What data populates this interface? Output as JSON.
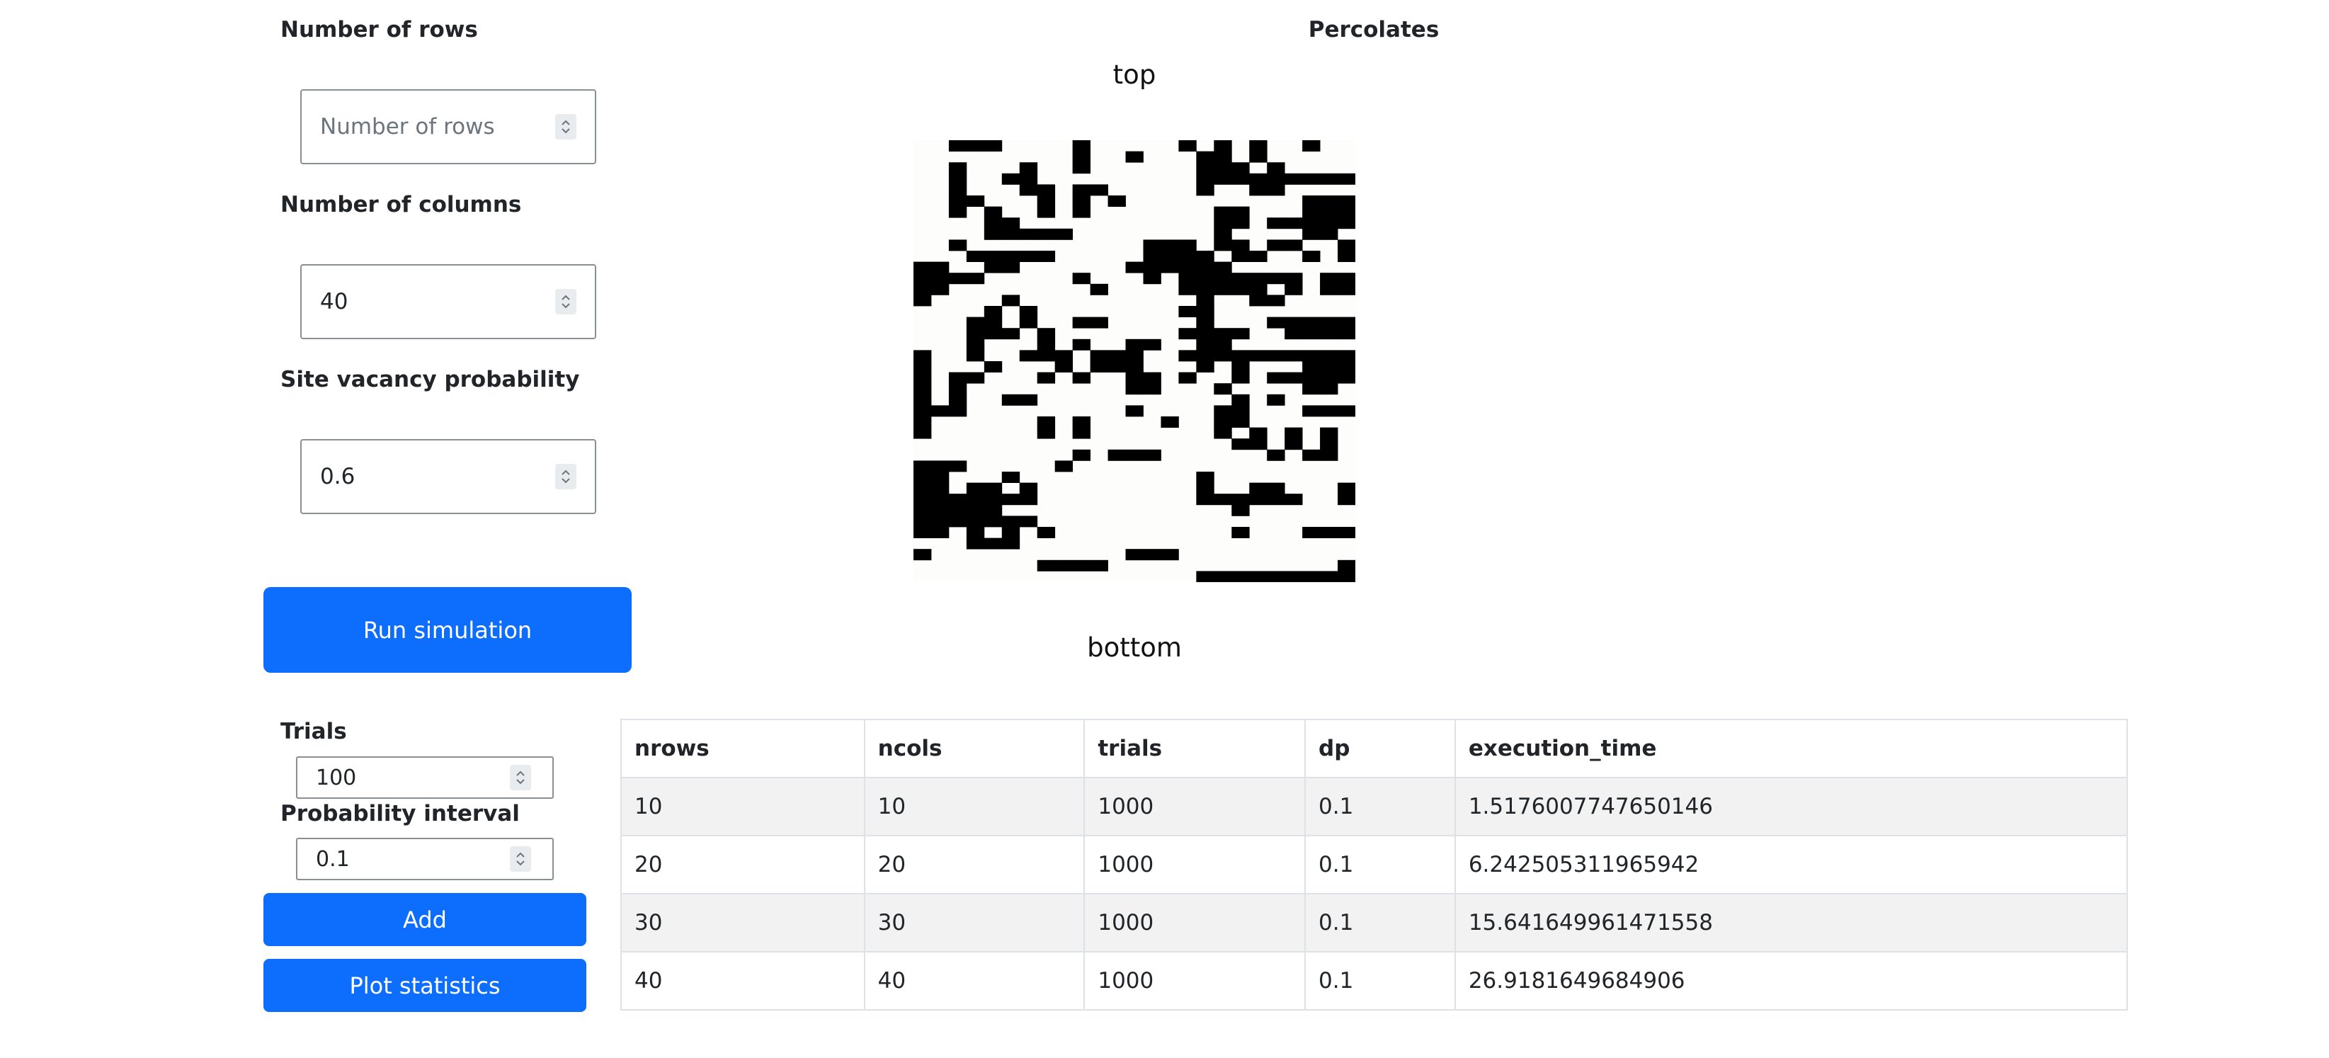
{
  "form": {
    "rows": {
      "label": "Number of rows",
      "value": "",
      "placeholder": "Number of rows"
    },
    "cols": {
      "label": "Number of columns",
      "value": "40",
      "placeholder": ""
    },
    "vacancy": {
      "label": "Site vacancy probability",
      "value": "0.6",
      "placeholder": ""
    },
    "run_button": "Run simulation"
  },
  "stats_form": {
    "trials": {
      "label": "Trials",
      "value": "100"
    },
    "interval": {
      "label": "Probability interval",
      "value": "0.1"
    },
    "add_button": "Add",
    "plot_button": "Plot statistics"
  },
  "lattice": {
    "title": "Percolates",
    "top_label": "top",
    "bottom_label": "bottom",
    "colors": {
      "blocked": "#000000",
      "open": "#fdfdfb"
    },
    "grid": [
      "0011100001000001010100100",
      "0000000001001000110100000",
      "0010001001000000111010000",
      "0010011000000000111111111",
      "0010001101100000100110000",
      "0011000101010000000000111",
      "0010100101000000011000111",
      "0000110000000000011011111",
      "0000111110000000010000110",
      "0010000000000111011011001",
      "0001111100000111101100101",
      "1100110000001111110000000",
      "1111000001000101111111011",
      "1100000000100001111101011",
      "1000010000000000100110000",
      "0000101000000001100000000",
      "0001101001100000100011111",
      "0001110100000001111001111",
      "0001000101001100110000000",
      "1001001110111001111111111",
      "1000100010111000101000111",
      "1011000101001101001011111",
      "1010000000001100010000110",
      "1010011000000000001010000",
      "1110000000001000011000111",
      "1000000101000010011000000",
      "1000000101000000010101010",
      "0000000000000000001101010",
      "0000000001011100000010110",
      "1110000010000000000000000",
      "1100010000000000100000000",
      "1101101000000000100110001",
      "1111111000000000111111001",
      "1111100000000000001000000",
      "1111111000000000000000000",
      "1101010100000000001000111",
      "0001110000000000000000000",
      "1000000000001110000000000",
      "0000000111100000000000001",
      "0000000000000000111111111"
    ]
  },
  "table": {
    "columns": [
      "nrows",
      "ncols",
      "trials",
      "dp",
      "execution_time"
    ],
    "rows": [
      [
        "10",
        "10",
        "1000",
        "0.1",
        "1.5176007747650146"
      ],
      [
        "20",
        "20",
        "1000",
        "0.1",
        "6.242505311965942"
      ],
      [
        "30",
        "30",
        "1000",
        "0.1",
        "15.641649961471558"
      ],
      [
        "40",
        "40",
        "1000",
        "0.1",
        "26.9181649684906"
      ]
    ]
  }
}
